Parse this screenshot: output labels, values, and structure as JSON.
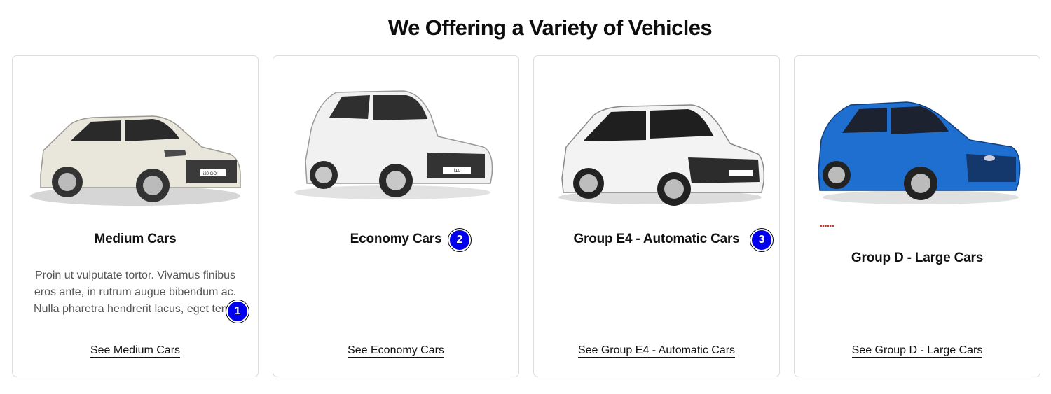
{
  "section": {
    "title": "We Offering a Variety of Vehicles"
  },
  "cards": [
    {
      "title": "Medium Cars",
      "description": "Proin ut vulputate tortor. Vivamus finibus eros ante, in rutrum augue bibendum ac. Nulla pharetra hendrerit lacus, eget temp",
      "desc_lines": [
        "Proin ut vulputate tortor. Vivamus finibus",
        "eros ante, in rutrum augue bibendum ac.",
        "Nulla pharetra hendrerit lacus, eget temp"
      ],
      "link": "See Medium Cars",
      "plate": "i20 GO!",
      "car_color": "#e9e6dc"
    },
    {
      "title": "Economy Cars",
      "link": "See Economy Cars",
      "plate": "i10",
      "car_color": "#f1f1f1"
    },
    {
      "title": "Group E4 - Automatic Cars",
      "link": "See Group E4 - Automatic Cars",
      "car_color": "#f3f3f3"
    },
    {
      "title": "Group D - Large Cars",
      "link": "See Group D - Large Cars",
      "car_color": "#1f6fd1"
    }
  ],
  "badges": [
    "1",
    "2",
    "3"
  ]
}
